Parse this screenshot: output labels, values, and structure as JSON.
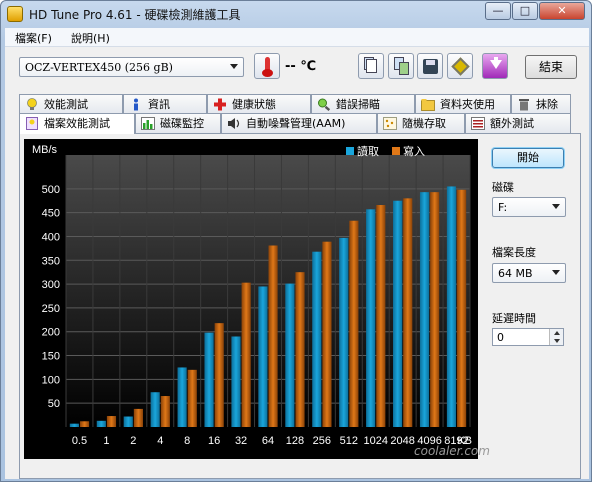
{
  "window": {
    "title": "HD Tune Pro 4.61 - 硬碟檢測維護工具",
    "min": "—",
    "max": "□",
    "close": "✕"
  },
  "menu": [
    "檔案(F)",
    "說明(H)"
  ],
  "toolbar": {
    "drive": "OCZ-VERTEX450 (256 gB)",
    "temperature": "-- ℃",
    "exit_label": "結束"
  },
  "tabs_row1": [
    "效能測試",
    "資訊",
    "健康狀態",
    "錯誤掃瞄",
    "資料夾使用",
    "抹除"
  ],
  "tabs_row2": [
    "檔案效能測試",
    "磁碟監控",
    "自動噪聲管理(AAM)",
    "隨機存取",
    "額外測試"
  ],
  "side": {
    "start_label": "開始",
    "disk_label": "磁碟",
    "disk_value": "F:",
    "size_label": "檔案長度",
    "size_value": "64 MB",
    "delay_label": "延遲時間",
    "delay_value": "0"
  },
  "watermark": "coolaler.com",
  "colors": {
    "read": "#1aa6dc",
    "write": "#e07818",
    "chart_bg": "#000000"
  },
  "chart_data": {
    "type": "bar",
    "ylabel": "MB/s",
    "xlabel_unit": "KB",
    "ylim": [
      0,
      550
    ],
    "yticks": [
      50,
      100,
      150,
      200,
      250,
      300,
      350,
      400,
      450,
      500
    ],
    "categories": [
      "0.5",
      "1",
      "2",
      "4",
      "8",
      "16",
      "32",
      "64",
      "128",
      "256",
      "512",
      "1024",
      "2048",
      "4096",
      "8192"
    ],
    "series": [
      {
        "name": "讀取",
        "values": [
          7,
          13,
          22,
          73,
          125,
          198,
          190,
          295,
          301,
          368,
          397,
          457,
          475,
          493,
          505
        ]
      },
      {
        "name": "寫入",
        "values": [
          12,
          23,
          38,
          65,
          120,
          218,
          303,
          381,
          325,
          389,
          433,
          466,
          480,
          493,
          498
        ]
      }
    ]
  }
}
